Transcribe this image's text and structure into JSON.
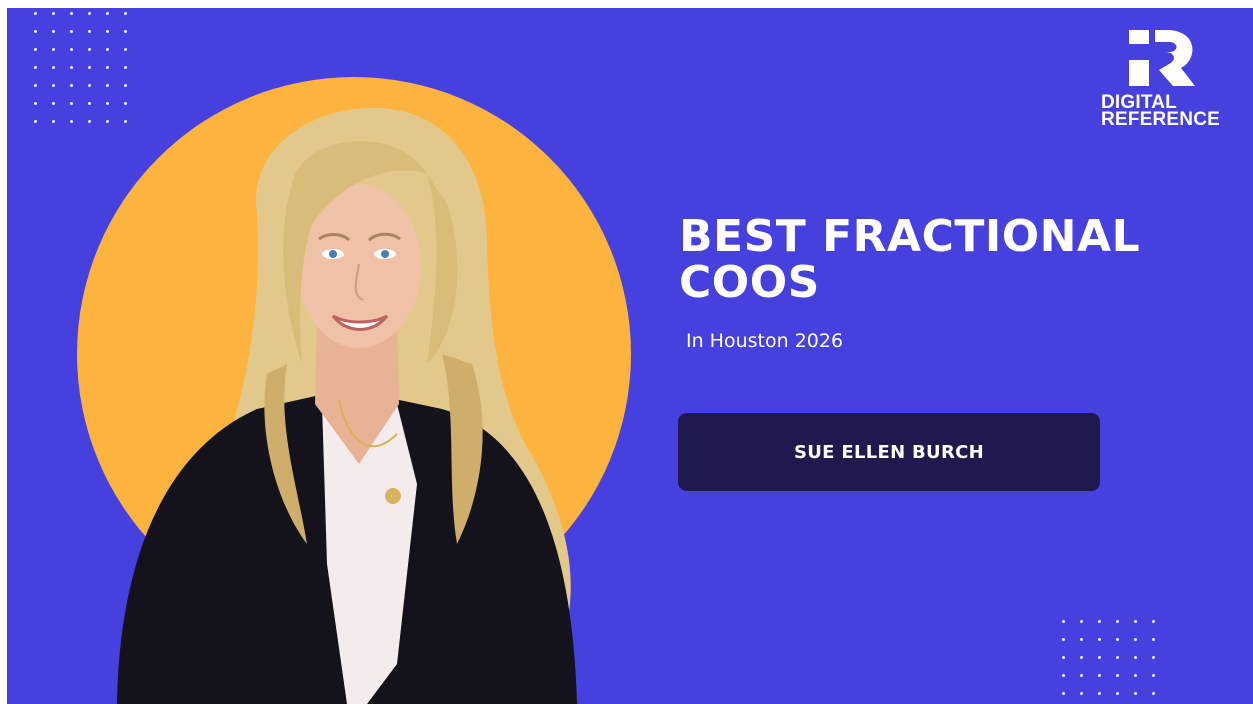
{
  "colors": {
    "background": "#4540de",
    "circle": "#fdb43f",
    "button": "#1e1a4d",
    "text": "#ffffff",
    "hair": "#e3c88c",
    "suit": "#14131c",
    "blouse": "#f4ecec",
    "skin": "#efc1a6"
  },
  "logo": {
    "line1": "DIGITAL",
    "line2": "REFERENCE"
  },
  "headline": {
    "line1": "BEST FRACTIONAL",
    "line2": "COOS"
  },
  "subtitle": "In Houston 2026",
  "name_button": {
    "label": "SUE ELLEN BURCH"
  },
  "icons": {
    "logo": "digital-reference-r-logo-icon",
    "dots": "dot-grid-icon"
  }
}
